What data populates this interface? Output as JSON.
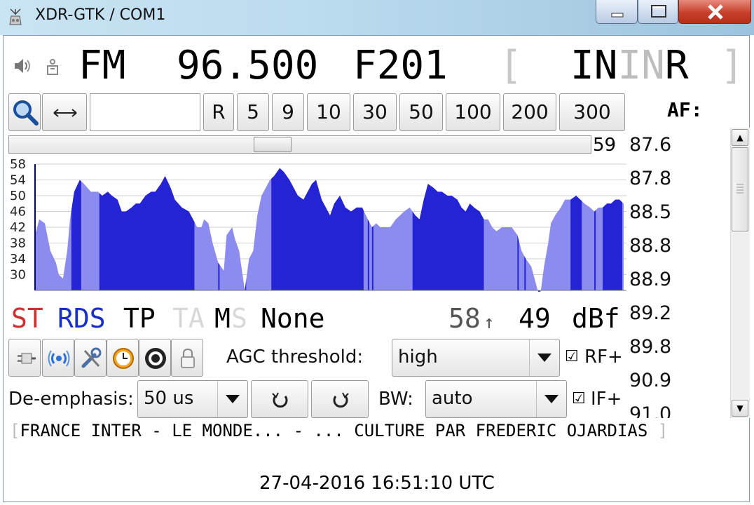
{
  "window": {
    "title": "XDR-GTK / COM1"
  },
  "tuner": {
    "mode": "FM",
    "frequency": "96.500",
    "pi": "F201",
    "ps_open": "[",
    "ps_chars": [
      {
        "ch": "I",
        "faded": false
      },
      {
        "ch": "N",
        "faded": false
      },
      {
        "ch": "I",
        "faded": true
      },
      {
        "ch": "N",
        "faded": true
      },
      {
        "ch": "R",
        "faded": false
      }
    ],
    "ps_close": "]"
  },
  "toolbar": {
    "steps": [
      "R",
      "5",
      "9",
      "10",
      "30",
      "50",
      "100",
      "200",
      "300"
    ],
    "af_label": "AF:"
  },
  "signal_slider": {
    "value_label": "59",
    "position": 0.45
  },
  "af_list": [
    "87.6",
    "87.8",
    "88.5",
    "88.8",
    "88.9",
    "89.2",
    "89.8",
    "90.9",
    "91.0"
  ],
  "graph": {
    "y_labels": [
      "58",
      "54",
      "50",
      "46",
      "42",
      "38",
      "34",
      "30"
    ],
    "colors": {
      "light": "#8c8cf0",
      "dark": "#2424d4",
      "line": "#000080"
    }
  },
  "status": {
    "st": "ST",
    "rds": "RDS",
    "tp": "TP",
    "ta": "TA",
    "ms_m": "M",
    "ms_s": "S",
    "pty": "None",
    "signal_max": "58",
    "signal_arrow": "↑",
    "signal_value": "49",
    "signal_unit": "dBf",
    "colors": {
      "st": "#d03030",
      "rds": "#1830c8",
      "faded": "#d8d8d8"
    }
  },
  "controls": {
    "agc_label": "AGC threshold:",
    "agc_value": "high",
    "rf_label": "RF+",
    "deemph_label": "De-emphasis:",
    "deemph_value": "50 us",
    "bw_label": "BW:",
    "bw_value": "auto",
    "if_label": "IF+",
    "check_mark": "☑"
  },
  "radiotext": {
    "open": "[",
    "text": "FRANCE INTER - LE MONDE... - ... CULTURE PAR FREDERIC OJARDIAS",
    "close": "]"
  },
  "clock": "27-04-2016 16:51:10 UTC"
}
